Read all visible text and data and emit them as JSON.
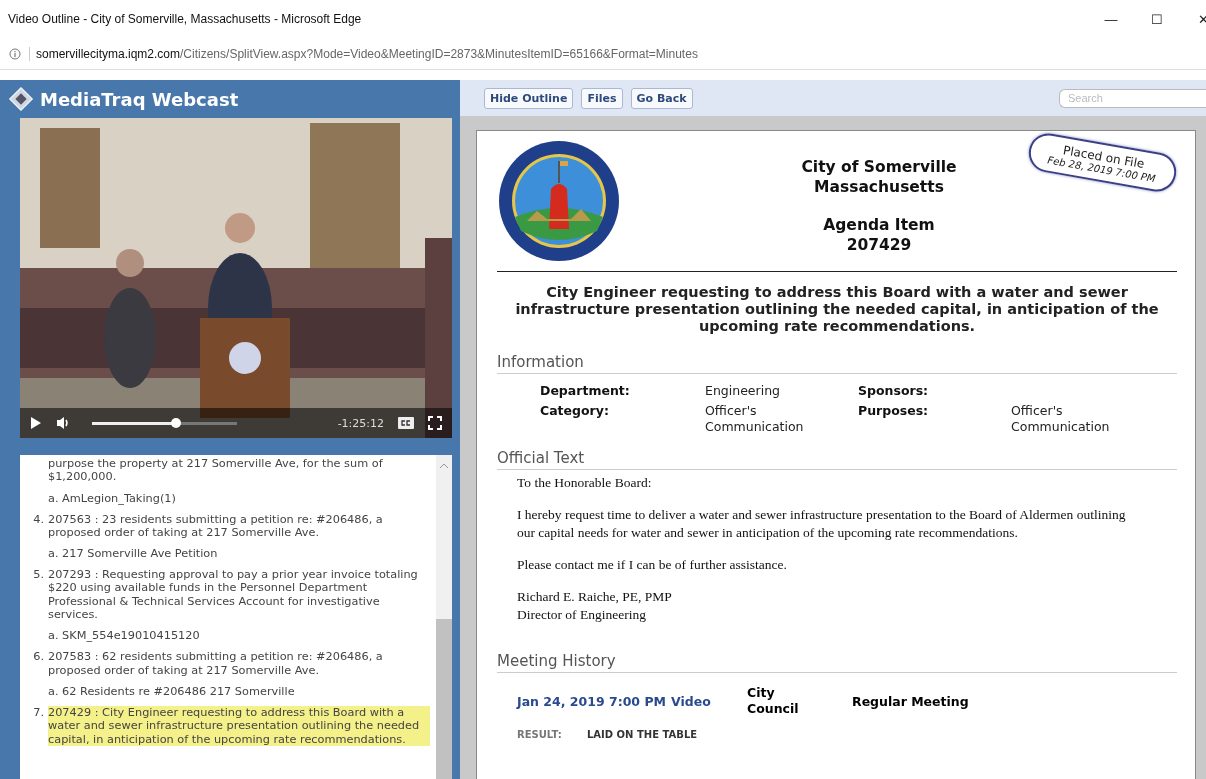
{
  "window": {
    "title": "Video Outline - City of Somerville, Massachusetts - Microsoft Edge",
    "controls": [
      "—",
      "☐",
      "✕"
    ]
  },
  "address_bar": {
    "url_host": "somervillecityma.iqm2.com",
    "url_path": "/Citizens/SplitView.aspx?Mode=Video&MeetingID=2873&MinutesItemID=65166&Format=Minutes"
  },
  "left_panel": {
    "title": "MediaTraq Webcast",
    "video": {
      "playing": false,
      "level": 0.58,
      "time": "-1:25:12"
    },
    "outline": [
      {
        "text": "purpose the property at 217 Somerville Ave, for the sum of $1,200,000.",
        "selected": false,
        "children": [
          {
            "text": "a. AmLegion_Taking(1)"
          }
        ]
      },
      {
        "number": "4.",
        "text": "207563 : 23 residents submitting a petition re: #206486, a proposed order of taking at 217 Somerville Ave.",
        "selected": false,
        "children": [
          {
            "text": "a. 217 Somerville Ave Petition"
          }
        ]
      },
      {
        "number": "5.",
        "text": "207293 : Requesting approval to pay a prior year invoice totaling $220 using available funds in the Personnel Department Professional & Technical Services Account for investigative services.",
        "selected": false,
        "children": [
          {
            "text": "a. SKM_554e19010415120"
          }
        ]
      },
      {
        "number": "6.",
        "text": "207583 : 62 residents submitting a petition re: #206486, a proposed order of taking at 217 Somerville Ave.",
        "selected": false,
        "children": [
          {
            "text": "a. 62 Residents re #206486 217 Somerville"
          }
        ]
      },
      {
        "number": "7.",
        "text": "207429 : City Engineer requesting to address this Board with a water and sewer infrastructure presentation outlining the needed capital, in anticipation of the upcoming rate recommendations.",
        "selected": true
      }
    ]
  },
  "toolbar": {
    "buttons": [
      "Hide Outline",
      "Files",
      "Go Back"
    ],
    "search": {
      "placeholder": "Search"
    }
  },
  "document": {
    "heading": [
      "City of Somerville",
      "Massachusetts"
    ],
    "item_label": "Agenda Item",
    "item_number": "207429",
    "stamp": {
      "status": "Placed on File",
      "date": "Feb 28, 2019 7:00 PM"
    },
    "title": "City Engineer requesting to address this Board with a water and sewer infrastructure presentation outlining the needed capital, in anticipation of the upcoming rate recommendations.",
    "information": {
      "heading": "Information",
      "fields": [
        {
          "label": "Department:",
          "value": "Engineering"
        },
        {
          "label": "Sponsors:"
        },
        {
          "label": "Category:",
          "value": "Officer's Communication"
        },
        {
          "label": "Purposes:",
          "value": "Officer's Communication"
        }
      ]
    },
    "official_text": {
      "heading": "Official Text",
      "paragraphs": [
        "To the Honorable Board:",
        "I hereby request time to deliver a water and sewer infrastructure presentation to the Board of Aldermen outlining our capital needs for water and sewer in anticipation of the upcoming rate recommendations.",
        "Please contact me if I can be of further assistance.",
        "Richard E. Raiche, PE, PMP\nDirector of Engineering"
      ]
    },
    "meeting_history": {
      "heading": "Meeting History",
      "entries": [
        {
          "date": "Jan 24, 2019 7:00 PM",
          "link": "Video",
          "body": "City Council",
          "type": "Regular Meeting",
          "result_label": "RESULT:",
          "result": "LAID ON THE TABLE"
        }
      ]
    }
  }
}
